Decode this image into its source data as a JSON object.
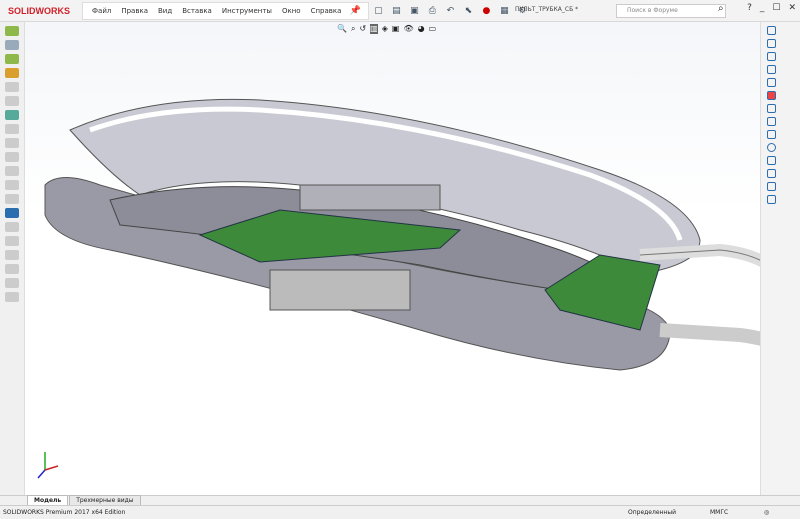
{
  "app": {
    "logo": "SOLIDWORKS",
    "document_title": "ПУЛЬТ_ТРУБКА_СБ *"
  },
  "menu": [
    "Файл",
    "Правка",
    "Вид",
    "Вставка",
    "Инструменты",
    "Окно",
    "Справка"
  ],
  "search": {
    "placeholder": "Поиск в Форуме"
  },
  "tabs": [
    "Модель",
    "Трехмерные виды"
  ],
  "status": {
    "product": "SOLIDWORKS Premium 2017 x64 Edition",
    "state": "Определенный",
    "units": "ММГС"
  },
  "colors": {
    "accent": "#d0202a",
    "pcb": "#3d8a3a",
    "shell": "#c9c9d3",
    "cut": "#ffffff"
  }
}
